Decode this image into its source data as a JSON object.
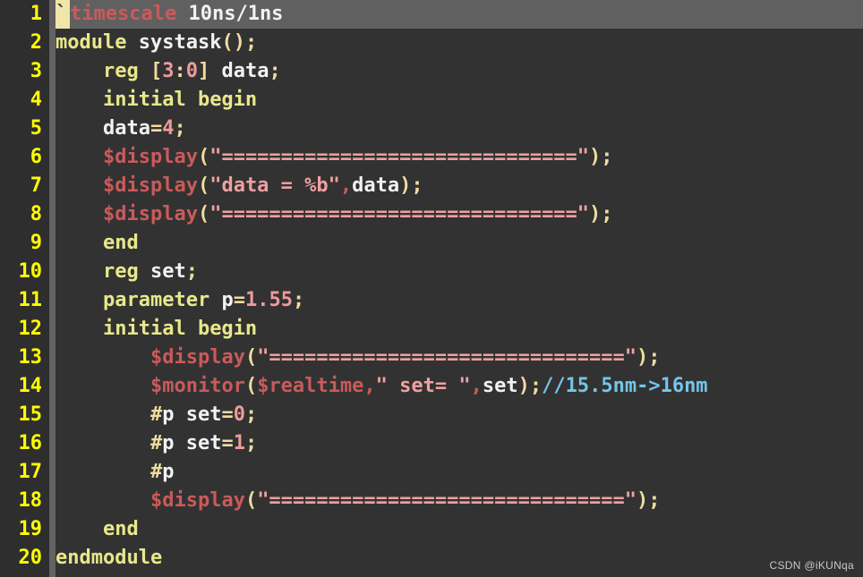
{
  "editor": {
    "theme_colors": {
      "background": "#323232",
      "gutter_background": "#2e2e2e",
      "fold_strip": "#636363",
      "current_line_highlight": "#606060",
      "line_number": "#ffff00",
      "keyword": "#e8e88c",
      "identifier": "#f2f2f2",
      "punctuation": "#f0dca0",
      "number": "#f09a9a",
      "system_function": "#cb5a5a",
      "string": "#f0a0a0",
      "comment": "#74c5e8",
      "cursor": "#f0e6a8"
    },
    "language": "verilog",
    "current_line": 1,
    "total_lines": 20
  },
  "watermark": {
    "text": "CSDN @iKUNqa"
  },
  "lines": [
    {
      "number": "1",
      "current": true,
      "tokens": [
        {
          "t": "`",
          "c": "cursor"
        },
        {
          "t": "timescale",
          "c": "func"
        },
        {
          "t": " ",
          "c": "id"
        },
        {
          "t": "10ns/1ns",
          "c": "id"
        }
      ]
    },
    {
      "number": "2",
      "current": false,
      "tokens": [
        {
          "t": "module",
          "c": "kw"
        },
        {
          "t": " ",
          "c": "id"
        },
        {
          "t": "systask",
          "c": "id"
        },
        {
          "t": "();",
          "c": "punc"
        }
      ]
    },
    {
      "number": "3",
      "current": false,
      "tokens": [
        {
          "t": "    ",
          "c": "id"
        },
        {
          "t": "reg",
          "c": "kw"
        },
        {
          "t": " ",
          "c": "id"
        },
        {
          "t": "[",
          "c": "punc"
        },
        {
          "t": "3",
          "c": "num"
        },
        {
          "t": ":",
          "c": "punc"
        },
        {
          "t": "0",
          "c": "num"
        },
        {
          "t": "]",
          "c": "punc"
        },
        {
          "t": " ",
          "c": "id"
        },
        {
          "t": "data",
          "c": "id"
        },
        {
          "t": ";",
          "c": "punc"
        }
      ]
    },
    {
      "number": "4",
      "current": false,
      "tokens": [
        {
          "t": "    ",
          "c": "id"
        },
        {
          "t": "initial begin",
          "c": "kw"
        }
      ]
    },
    {
      "number": "5",
      "current": false,
      "tokens": [
        {
          "t": "    ",
          "c": "id"
        },
        {
          "t": "data",
          "c": "id"
        },
        {
          "t": "=",
          "c": "punc"
        },
        {
          "t": "4",
          "c": "num"
        },
        {
          "t": ";",
          "c": "punc"
        }
      ]
    },
    {
      "number": "6",
      "current": false,
      "tokens": [
        {
          "t": "    ",
          "c": "id"
        },
        {
          "t": "$display",
          "c": "func"
        },
        {
          "t": "(",
          "c": "punc"
        },
        {
          "t": "\"==============================\"",
          "c": "str"
        },
        {
          "t": ");",
          "c": "punc"
        }
      ]
    },
    {
      "number": "7",
      "current": false,
      "tokens": [
        {
          "t": "    ",
          "c": "id"
        },
        {
          "t": "$display",
          "c": "func"
        },
        {
          "t": "(",
          "c": "punc"
        },
        {
          "t": "\"data = %b\"",
          "c": "str"
        },
        {
          "t": ",",
          "c": "func"
        },
        {
          "t": "data",
          "c": "id"
        },
        {
          "t": ");",
          "c": "punc"
        }
      ]
    },
    {
      "number": "8",
      "current": false,
      "tokens": [
        {
          "t": "    ",
          "c": "id"
        },
        {
          "t": "$display",
          "c": "func"
        },
        {
          "t": "(",
          "c": "punc"
        },
        {
          "t": "\"==============================\"",
          "c": "str"
        },
        {
          "t": ");",
          "c": "punc"
        }
      ]
    },
    {
      "number": "9",
      "current": false,
      "tokens": [
        {
          "t": "    ",
          "c": "id"
        },
        {
          "t": "end",
          "c": "kw"
        }
      ]
    },
    {
      "number": "10",
      "current": false,
      "tokens": [
        {
          "t": "    ",
          "c": "id"
        },
        {
          "t": "reg",
          "c": "kw"
        },
        {
          "t": " ",
          "c": "id"
        },
        {
          "t": "set",
          "c": "id"
        },
        {
          "t": ";",
          "c": "punc"
        }
      ]
    },
    {
      "number": "11",
      "current": false,
      "tokens": [
        {
          "t": "    ",
          "c": "id"
        },
        {
          "t": "parameter",
          "c": "kw"
        },
        {
          "t": " ",
          "c": "id"
        },
        {
          "t": "p",
          "c": "id"
        },
        {
          "t": "=",
          "c": "punc"
        },
        {
          "t": "1.55",
          "c": "num"
        },
        {
          "t": ";",
          "c": "punc"
        }
      ]
    },
    {
      "number": "12",
      "current": false,
      "tokens": [
        {
          "t": "    ",
          "c": "id"
        },
        {
          "t": "initial begin",
          "c": "kw"
        }
      ]
    },
    {
      "number": "13",
      "current": false,
      "tokens": [
        {
          "t": "        ",
          "c": "id"
        },
        {
          "t": "$display",
          "c": "func"
        },
        {
          "t": "(",
          "c": "punc"
        },
        {
          "t": "\"==============================\"",
          "c": "str"
        },
        {
          "t": ");",
          "c": "punc"
        }
      ]
    },
    {
      "number": "14",
      "current": false,
      "tokens": [
        {
          "t": "        ",
          "c": "id"
        },
        {
          "t": "$monitor",
          "c": "func"
        },
        {
          "t": "(",
          "c": "punc"
        },
        {
          "t": "$realtime",
          "c": "func"
        },
        {
          "t": ",",
          "c": "func"
        },
        {
          "t": "\" set= \"",
          "c": "str"
        },
        {
          "t": ",",
          "c": "func"
        },
        {
          "t": "set",
          "c": "id"
        },
        {
          "t": ");",
          "c": "punc"
        },
        {
          "t": "//15.5nm->16nm",
          "c": "cmt"
        }
      ]
    },
    {
      "number": "15",
      "current": false,
      "tokens": [
        {
          "t": "        ",
          "c": "id"
        },
        {
          "t": "#",
          "c": "punc"
        },
        {
          "t": "p",
          "c": "id"
        },
        {
          "t": " ",
          "c": "id"
        },
        {
          "t": "set",
          "c": "id"
        },
        {
          "t": "=",
          "c": "punc"
        },
        {
          "t": "0",
          "c": "num"
        },
        {
          "t": ";",
          "c": "punc"
        }
      ]
    },
    {
      "number": "16",
      "current": false,
      "tokens": [
        {
          "t": "        ",
          "c": "id"
        },
        {
          "t": "#",
          "c": "punc"
        },
        {
          "t": "p",
          "c": "id"
        },
        {
          "t": " ",
          "c": "id"
        },
        {
          "t": "set",
          "c": "id"
        },
        {
          "t": "=",
          "c": "punc"
        },
        {
          "t": "1",
          "c": "num"
        },
        {
          "t": ";",
          "c": "punc"
        }
      ]
    },
    {
      "number": "17",
      "current": false,
      "tokens": [
        {
          "t": "        ",
          "c": "id"
        },
        {
          "t": "#",
          "c": "punc"
        },
        {
          "t": "p",
          "c": "id"
        }
      ]
    },
    {
      "number": "18",
      "current": false,
      "tokens": [
        {
          "t": "        ",
          "c": "id"
        },
        {
          "t": "$display",
          "c": "func"
        },
        {
          "t": "(",
          "c": "punc"
        },
        {
          "t": "\"==============================\"",
          "c": "str"
        },
        {
          "t": ");",
          "c": "punc"
        }
      ]
    },
    {
      "number": "19",
      "current": false,
      "tokens": [
        {
          "t": "    ",
          "c": "id"
        },
        {
          "t": "end",
          "c": "kw"
        }
      ]
    },
    {
      "number": "20",
      "current": false,
      "tokens": [
        {
          "t": "endmodule",
          "c": "kw"
        }
      ]
    }
  ]
}
